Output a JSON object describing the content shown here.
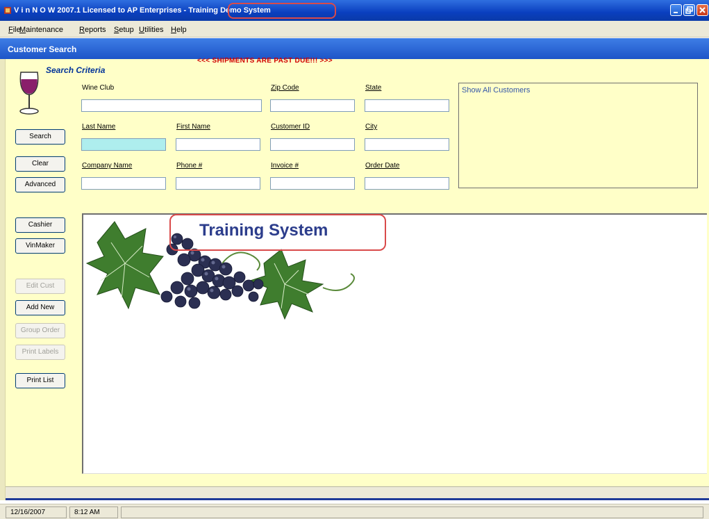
{
  "window": {
    "title": "V i n N O W  2007.1 Licensed to AP Enterprises - Training Demo System",
    "title_main": "V i n N O W  2007.1 Licensed to AP Enterprises - ",
    "title_highlight": "Training Demo System"
  },
  "menu": {
    "items": [
      {
        "u": "F",
        "rest": "ile"
      },
      {
        "u": "M",
        "rest": "aintenance"
      },
      {
        "u": "R",
        "rest": "eports"
      },
      {
        "u": "S",
        "rest": "etup"
      },
      {
        "u": "U",
        "rest": "tilities"
      },
      {
        "u": "H",
        "rest": "elp"
      }
    ]
  },
  "form": {
    "title": "Customer Search",
    "search_criteria_label": "Search Criteria",
    "alert": "<<<  SHIPMENTS ARE PAST DUE!!!  >>>",
    "fields": {
      "wine_club": {
        "label": "Wine Club",
        "value": ""
      },
      "zip_code": {
        "label": "Zip Code",
        "value": ""
      },
      "state": {
        "label": "State",
        "value": ""
      },
      "last_name": {
        "label": "Last Name",
        "value": ""
      },
      "first_name": {
        "label": "First Name",
        "value": ""
      },
      "customer_id": {
        "label": "Customer ID",
        "value": ""
      },
      "city": {
        "label": "City",
        "value": ""
      },
      "company_name": {
        "label": "Company Name",
        "value": ""
      },
      "phone": {
        "label": "Phone #",
        "value": ""
      },
      "invoice": {
        "label": "Invoice #",
        "value": ""
      },
      "order_date": {
        "label": "Order Date",
        "value": ""
      }
    },
    "buttons": {
      "search": "Search",
      "clear": "Clear",
      "advanced": "Advanced",
      "cashier": "Cashier",
      "vinmaker": "VinMaker",
      "edit_cust": "Edit Cust",
      "add_new": "Add New",
      "group_order": "Group Order",
      "print_labels": "Print Labels",
      "print_list": "Print List"
    },
    "show_all_customers": "Show All Customers",
    "banner": "Training System"
  },
  "status": {
    "date": "12/16/2007",
    "time": "8:12 AM"
  },
  "colors": {
    "form_background": "#ffffc8",
    "title_bar": "#0a3fbf",
    "alert_text": "#d00000",
    "highlight_border": "#d94a4a",
    "active_field": "#aeeeee"
  }
}
